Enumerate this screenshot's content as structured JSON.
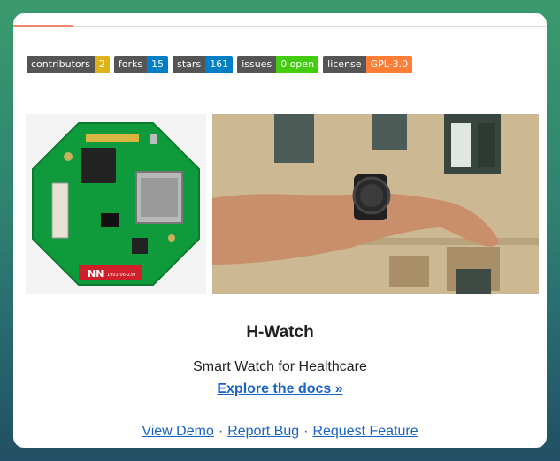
{
  "badges": [
    {
      "key": "contributors",
      "value": "2",
      "color": "#dfb317"
    },
    {
      "key": "forks",
      "value": "15",
      "color": "#007ec6"
    },
    {
      "key": "stars",
      "value": "161",
      "color": "#007ec6"
    },
    {
      "key": "issues",
      "value": "0 open",
      "color": "#4c1"
    },
    {
      "key": "license",
      "value": "GPL-3.0",
      "color": "#fe7d37"
    }
  ],
  "images": {
    "board_label": "NN",
    "board_marking": "1901-06-239"
  },
  "project": {
    "title": "H-Watch",
    "subtitle": "Smart Watch for Healthcare",
    "docs_link": "Explore the docs »"
  },
  "links": {
    "demo": "View Demo",
    "bug": "Report Bug",
    "feature": "Request Feature",
    "separator": "·"
  }
}
